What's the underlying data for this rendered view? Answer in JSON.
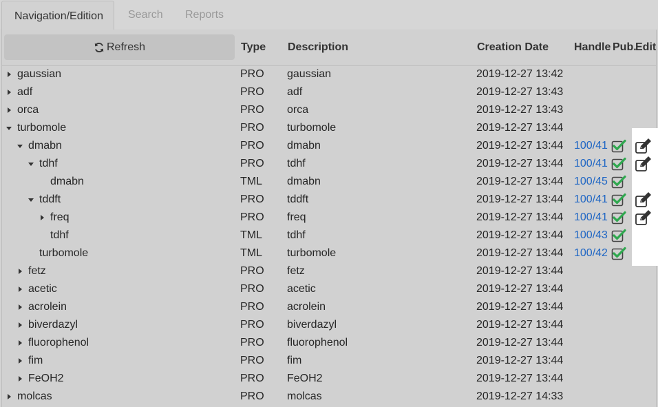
{
  "tabs": [
    {
      "label": "Navigation/Edition",
      "active": true
    },
    {
      "label": "Search",
      "active": false
    },
    {
      "label": "Reports",
      "active": false
    }
  ],
  "toolbar": {
    "refresh_label": "Refresh"
  },
  "columns": {
    "type": "Type",
    "description": "Description",
    "creation_date": "Creation Date",
    "handle": "Handle",
    "pub": "Pub.",
    "edit": "Edit"
  },
  "colors": {
    "handle_link": "#1f66c4",
    "check_green": "#2fa84f",
    "highlight": "#ffffff"
  },
  "rows": [
    {
      "name": "gaussian",
      "level": 0,
      "toggle": "collapsed",
      "type": "PRO",
      "description": "gaussian",
      "date": "2019-12-27 13:42",
      "handle": "",
      "pub": false,
      "edit": false
    },
    {
      "name": "adf",
      "level": 0,
      "toggle": "collapsed",
      "type": "PRO",
      "description": "adf",
      "date": "2019-12-27 13:43",
      "handle": "",
      "pub": false,
      "edit": false
    },
    {
      "name": "orca",
      "level": 0,
      "toggle": "collapsed",
      "type": "PRO",
      "description": "orca",
      "date": "2019-12-27 13:43",
      "handle": "",
      "pub": false,
      "edit": false
    },
    {
      "name": "turbomole",
      "level": 0,
      "toggle": "expanded",
      "type": "PRO",
      "description": "turbomole",
      "date": "2019-12-27 13:44",
      "handle": "",
      "pub": false,
      "edit": false
    },
    {
      "name": "dmabn",
      "level": 1,
      "toggle": "expanded",
      "type": "PRO",
      "description": "dmabn",
      "date": "2019-12-27 13:44",
      "handle": "100/41",
      "pub": true,
      "edit": true
    },
    {
      "name": "tdhf",
      "level": 2,
      "toggle": "expanded",
      "type": "PRO",
      "description": "tdhf",
      "date": "2019-12-27 13:44",
      "handle": "100/41",
      "pub": true,
      "edit": true
    },
    {
      "name": "dmabn",
      "level": 3,
      "toggle": "none",
      "type": "TML",
      "description": "dmabn",
      "date": "2019-12-27 13:44",
      "handle": "100/45",
      "pub": true,
      "edit": false
    },
    {
      "name": "tddft",
      "level": 2,
      "toggle": "expanded",
      "type": "PRO",
      "description": "tddft",
      "date": "2019-12-27 13:44",
      "handle": "100/41",
      "pub": true,
      "edit": true
    },
    {
      "name": "freq",
      "level": 3,
      "toggle": "collapsed",
      "type": "PRO",
      "description": "freq",
      "date": "2019-12-27 13:44",
      "handle": "100/41",
      "pub": true,
      "edit": true
    },
    {
      "name": "tdhf",
      "level": 3,
      "toggle": "none",
      "type": "TML",
      "description": "tdhf",
      "date": "2019-12-27 13:44",
      "handle": "100/43",
      "pub": true,
      "edit": false
    },
    {
      "name": "turbomole",
      "level": 2,
      "toggle": "none",
      "type": "TML",
      "description": "turbomole",
      "date": "2019-12-27 13:44",
      "handle": "100/42",
      "pub": true,
      "edit": false
    },
    {
      "name": "fetz",
      "level": 1,
      "toggle": "collapsed",
      "type": "PRO",
      "description": "fetz",
      "date": "2019-12-27 13:44",
      "handle": "",
      "pub": false,
      "edit": false
    },
    {
      "name": "acetic",
      "level": 1,
      "toggle": "collapsed",
      "type": "PRO",
      "description": "acetic",
      "date": "2019-12-27 13:44",
      "handle": "",
      "pub": false,
      "edit": false
    },
    {
      "name": "acrolein",
      "level": 1,
      "toggle": "collapsed",
      "type": "PRO",
      "description": "acrolein",
      "date": "2019-12-27 13:44",
      "handle": "",
      "pub": false,
      "edit": false
    },
    {
      "name": "biverdazyl",
      "level": 1,
      "toggle": "collapsed",
      "type": "PRO",
      "description": "biverdazyl",
      "date": "2019-12-27 13:44",
      "handle": "",
      "pub": false,
      "edit": false
    },
    {
      "name": "fluorophenol",
      "level": 1,
      "toggle": "collapsed",
      "type": "PRO",
      "description": "fluorophenol",
      "date": "2019-12-27 13:44",
      "handle": "",
      "pub": false,
      "edit": false
    },
    {
      "name": "fim",
      "level": 1,
      "toggle": "collapsed",
      "type": "PRO",
      "description": "fim",
      "date": "2019-12-27 13:44",
      "handle": "",
      "pub": false,
      "edit": false
    },
    {
      "name": "FeOH2",
      "level": 1,
      "toggle": "collapsed",
      "type": "PRO",
      "description": "FeOH2",
      "date": "2019-12-27 13:44",
      "handle": "",
      "pub": false,
      "edit": false
    },
    {
      "name": "molcas",
      "level": 0,
      "toggle": "collapsed",
      "type": "PRO",
      "description": "molcas",
      "date": "2019-12-27 14:33",
      "handle": "",
      "pub": false,
      "edit": false
    }
  ]
}
